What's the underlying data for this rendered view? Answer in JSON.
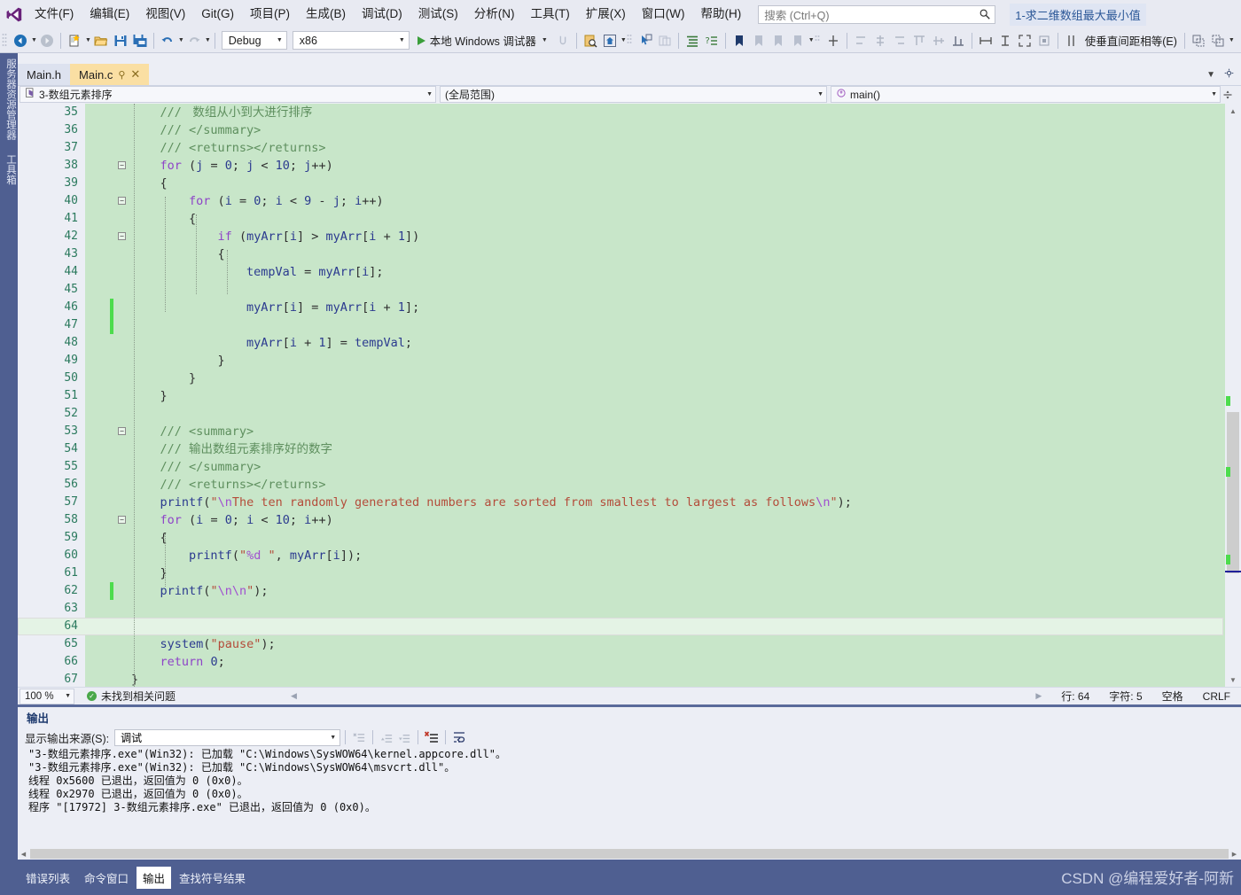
{
  "menubar": {
    "logo_icon": "visual-studio-logo",
    "items": [
      {
        "label": "文件(F)"
      },
      {
        "label": "编辑(E)"
      },
      {
        "label": "视图(V)"
      },
      {
        "label": "Git(G)"
      },
      {
        "label": "项目(P)"
      },
      {
        "label": "生成(B)"
      },
      {
        "label": "调试(D)"
      },
      {
        "label": "测试(S)"
      },
      {
        "label": "分析(N)"
      },
      {
        "label": "工具(T)"
      },
      {
        "label": "扩展(X)"
      },
      {
        "label": "窗口(W)"
      },
      {
        "label": "帮助(H)"
      }
    ],
    "search_placeholder": "搜索 (Ctrl+Q)",
    "search_icon": "search-icon",
    "project_chip": "1-求二维数组最大最小值"
  },
  "toolbar": {
    "nav_back_icon": "navigate-back-icon",
    "nav_forward_icon": "navigate-forward-icon",
    "new_item_icon": "new-item-icon",
    "open_file_icon": "open-folder-icon",
    "save_icon": "save-icon",
    "save_all_icon": "save-all-icon",
    "undo_icon": "undo-icon",
    "redo_icon": "redo-icon",
    "config_value": "Debug",
    "platform_value": "x86",
    "run_label": "本地 Windows 调试器",
    "run_icon": "play-icon",
    "equal_vertical_spacing_label": "使垂直间距相等(E)"
  },
  "left_dock": {
    "tabs": [
      {
        "label": "服务器资源管理器"
      },
      {
        "label": "工具箱"
      }
    ]
  },
  "editor": {
    "tabs": [
      {
        "label": "Main.h",
        "active": false,
        "pinned": false,
        "closable": false
      },
      {
        "label": "Main.c",
        "active": true,
        "pinned": true,
        "closable": true
      }
    ],
    "pin_icon": "pin-icon",
    "close_icon": "close-icon",
    "navbar": {
      "project_icon": "c-file-icon",
      "project": "3-数组元素排序",
      "scope": "(全局范围)",
      "member_icon": "method-icon",
      "member": "main()",
      "split_icon": "split-editor-icon"
    },
    "first_line_number": 35,
    "current_line": 64,
    "lines": [
      {
        "n": 35,
        "indent": 1,
        "changed": false,
        "fold": null,
        "tokens": [
          {
            "t": "com",
            "s": "/// "
          },
          {
            "t": "cjk",
            "s": " 数组从小到大进行排序"
          }
        ]
      },
      {
        "n": 36,
        "indent": 1,
        "changed": false,
        "fold": null,
        "tokens": [
          {
            "t": "com",
            "s": "/// </summary>"
          }
        ]
      },
      {
        "n": 37,
        "indent": 1,
        "changed": false,
        "fold": null,
        "tokens": [
          {
            "t": "com",
            "s": "/// <returns></returns>"
          }
        ]
      },
      {
        "n": 38,
        "indent": 1,
        "changed": false,
        "fold": "minus",
        "tokens": [
          {
            "t": "kw",
            "s": "for"
          },
          {
            "t": "pun",
            "s": " ("
          },
          {
            "t": "var",
            "s": "j"
          },
          {
            "t": "pun",
            "s": " = "
          },
          {
            "t": "num",
            "s": "0"
          },
          {
            "t": "pun",
            "s": "; "
          },
          {
            "t": "var",
            "s": "j"
          },
          {
            "t": "pun",
            "s": " < "
          },
          {
            "t": "num",
            "s": "10"
          },
          {
            "t": "pun",
            "s": "; "
          },
          {
            "t": "var",
            "s": "j"
          },
          {
            "t": "pun",
            "s": "++)"
          }
        ]
      },
      {
        "n": 39,
        "indent": 1,
        "changed": false,
        "fold": null,
        "tokens": [
          {
            "t": "pun",
            "s": "{"
          }
        ]
      },
      {
        "n": 40,
        "indent": 2,
        "changed": false,
        "fold": "minus",
        "tokens": [
          {
            "t": "kw",
            "s": "for"
          },
          {
            "t": "pun",
            "s": " ("
          },
          {
            "t": "var",
            "s": "i"
          },
          {
            "t": "pun",
            "s": " = "
          },
          {
            "t": "num",
            "s": "0"
          },
          {
            "t": "pun",
            "s": "; "
          },
          {
            "t": "var",
            "s": "i"
          },
          {
            "t": "pun",
            "s": " < "
          },
          {
            "t": "num",
            "s": "9"
          },
          {
            "t": "pun",
            "s": " - "
          },
          {
            "t": "var",
            "s": "j"
          },
          {
            "t": "pun",
            "s": "; "
          },
          {
            "t": "var",
            "s": "i"
          },
          {
            "t": "pun",
            "s": "++)"
          }
        ]
      },
      {
        "n": 41,
        "indent": 2,
        "changed": false,
        "fold": null,
        "tokens": [
          {
            "t": "pun",
            "s": "{"
          }
        ]
      },
      {
        "n": 42,
        "indent": 3,
        "changed": false,
        "fold": "minus",
        "tokens": [
          {
            "t": "kw",
            "s": "if"
          },
          {
            "t": "pun",
            "s": " ("
          },
          {
            "t": "var",
            "s": "myArr"
          },
          {
            "t": "pun",
            "s": "["
          },
          {
            "t": "var",
            "s": "i"
          },
          {
            "t": "pun",
            "s": "] > "
          },
          {
            "t": "var",
            "s": "myArr"
          },
          {
            "t": "pun",
            "s": "["
          },
          {
            "t": "var",
            "s": "i"
          },
          {
            "t": "pun",
            "s": " + "
          },
          {
            "t": "num",
            "s": "1"
          },
          {
            "t": "pun",
            "s": "])"
          }
        ]
      },
      {
        "n": 43,
        "indent": 3,
        "changed": false,
        "fold": null,
        "tokens": [
          {
            "t": "pun",
            "s": "{"
          }
        ]
      },
      {
        "n": 44,
        "indent": 4,
        "changed": false,
        "fold": null,
        "tokens": [
          {
            "t": "var",
            "s": "tempVal"
          },
          {
            "t": "pun",
            "s": " = "
          },
          {
            "t": "var",
            "s": "myArr"
          },
          {
            "t": "pun",
            "s": "["
          },
          {
            "t": "var",
            "s": "i"
          },
          {
            "t": "pun",
            "s": "];"
          }
        ]
      },
      {
        "n": 45,
        "indent": 0,
        "changed": false,
        "fold": null,
        "tokens": []
      },
      {
        "n": 46,
        "indent": 4,
        "changed": true,
        "fold": null,
        "tokens": [
          {
            "t": "var",
            "s": "myArr"
          },
          {
            "t": "pun",
            "s": "["
          },
          {
            "t": "var",
            "s": "i"
          },
          {
            "t": "pun",
            "s": "] = "
          },
          {
            "t": "var",
            "s": "myArr"
          },
          {
            "t": "pun",
            "s": "["
          },
          {
            "t": "var",
            "s": "i"
          },
          {
            "t": "pun",
            "s": " + "
          },
          {
            "t": "num",
            "s": "1"
          },
          {
            "t": "pun",
            "s": "];"
          }
        ]
      },
      {
        "n": 47,
        "indent": 0,
        "changed": true,
        "fold": null,
        "tokens": []
      },
      {
        "n": 48,
        "indent": 4,
        "changed": false,
        "fold": null,
        "tokens": [
          {
            "t": "var",
            "s": "myArr"
          },
          {
            "t": "pun",
            "s": "["
          },
          {
            "t": "var",
            "s": "i"
          },
          {
            "t": "pun",
            "s": " + "
          },
          {
            "t": "num",
            "s": "1"
          },
          {
            "t": "pun",
            "s": "] = "
          },
          {
            "t": "var",
            "s": "tempVal"
          },
          {
            "t": "pun",
            "s": ";"
          }
        ]
      },
      {
        "n": 49,
        "indent": 3,
        "changed": false,
        "fold": null,
        "tokens": [
          {
            "t": "pun",
            "s": "}"
          }
        ]
      },
      {
        "n": 50,
        "indent": 2,
        "changed": false,
        "fold": null,
        "tokens": [
          {
            "t": "pun",
            "s": "}"
          }
        ]
      },
      {
        "n": 51,
        "indent": 1,
        "changed": false,
        "fold": null,
        "tokens": [
          {
            "t": "pun",
            "s": "}"
          }
        ]
      },
      {
        "n": 52,
        "indent": 0,
        "changed": false,
        "fold": null,
        "tokens": []
      },
      {
        "n": 53,
        "indent": 1,
        "changed": false,
        "fold": "minus",
        "tokens": [
          {
            "t": "com",
            "s": "/// <summary>"
          }
        ]
      },
      {
        "n": 54,
        "indent": 1,
        "changed": false,
        "fold": null,
        "tokens": [
          {
            "t": "com",
            "s": "/// "
          },
          {
            "t": "cjk",
            "s": "输出数组元素排序好的数字"
          }
        ]
      },
      {
        "n": 55,
        "indent": 1,
        "changed": false,
        "fold": null,
        "tokens": [
          {
            "t": "com",
            "s": "/// </summary>"
          }
        ]
      },
      {
        "n": 56,
        "indent": 1,
        "changed": false,
        "fold": null,
        "tokens": [
          {
            "t": "com",
            "s": "/// <returns></returns>"
          }
        ]
      },
      {
        "n": 57,
        "indent": 1,
        "changed": false,
        "fold": null,
        "tokens": [
          {
            "t": "fn",
            "s": "printf"
          },
          {
            "t": "pun",
            "s": "("
          },
          {
            "t": "str",
            "s": "\""
          },
          {
            "t": "esc",
            "s": "\\n"
          },
          {
            "t": "str",
            "s": "The ten randomly generated numbers are sorted from smallest to largest as follows"
          },
          {
            "t": "esc",
            "s": "\\n"
          },
          {
            "t": "str",
            "s": "\""
          },
          {
            "t": "pun",
            "s": ");"
          }
        ]
      },
      {
        "n": 58,
        "indent": 1,
        "changed": false,
        "fold": "minus",
        "tokens": [
          {
            "t": "kw",
            "s": "for"
          },
          {
            "t": "pun",
            "s": " ("
          },
          {
            "t": "var",
            "s": "i"
          },
          {
            "t": "pun",
            "s": " = "
          },
          {
            "t": "num",
            "s": "0"
          },
          {
            "t": "pun",
            "s": "; "
          },
          {
            "t": "var",
            "s": "i"
          },
          {
            "t": "pun",
            "s": " < "
          },
          {
            "t": "num",
            "s": "10"
          },
          {
            "t": "pun",
            "s": "; "
          },
          {
            "t": "var",
            "s": "i"
          },
          {
            "t": "pun",
            "s": "++)"
          }
        ]
      },
      {
        "n": 59,
        "indent": 1,
        "changed": false,
        "fold": null,
        "tokens": [
          {
            "t": "pun",
            "s": "{"
          }
        ]
      },
      {
        "n": 60,
        "indent": 2,
        "changed": false,
        "fold": null,
        "tokens": [
          {
            "t": "fn",
            "s": "printf"
          },
          {
            "t": "pun",
            "s": "("
          },
          {
            "t": "str",
            "s": "\""
          },
          {
            "t": "esc",
            "s": "%d"
          },
          {
            "t": "str",
            "s": " \""
          },
          {
            "t": "pun",
            "s": ", "
          },
          {
            "t": "var",
            "s": "myArr"
          },
          {
            "t": "pun",
            "s": "["
          },
          {
            "t": "var",
            "s": "i"
          },
          {
            "t": "pun",
            "s": "]);"
          }
        ]
      },
      {
        "n": 61,
        "indent": 1,
        "changed": false,
        "fold": null,
        "tokens": [
          {
            "t": "pun",
            "s": "}"
          }
        ]
      },
      {
        "n": 62,
        "indent": 1,
        "changed": true,
        "fold": null,
        "tokens": [
          {
            "t": "fn",
            "s": "printf"
          },
          {
            "t": "pun",
            "s": "("
          },
          {
            "t": "str",
            "s": "\""
          },
          {
            "t": "esc",
            "s": "\\n\\n"
          },
          {
            "t": "str",
            "s": "\""
          },
          {
            "t": "pun",
            "s": ");"
          }
        ]
      },
      {
        "n": 63,
        "indent": 0,
        "changed": false,
        "fold": null,
        "tokens": []
      },
      {
        "n": 64,
        "indent": 0,
        "changed": false,
        "fold": null,
        "tokens": []
      },
      {
        "n": 65,
        "indent": 1,
        "changed": false,
        "fold": null,
        "tokens": [
          {
            "t": "fn",
            "s": "system"
          },
          {
            "t": "pun",
            "s": "("
          },
          {
            "t": "str",
            "s": "\"pause\""
          },
          {
            "t": "pun",
            "s": ");"
          }
        ]
      },
      {
        "n": 66,
        "indent": 1,
        "changed": false,
        "fold": null,
        "tokens": [
          {
            "t": "kw",
            "s": "return"
          },
          {
            "t": "pun",
            "s": " "
          },
          {
            "t": "num",
            "s": "0"
          },
          {
            "t": "pun",
            "s": ";"
          }
        ]
      },
      {
        "n": 67,
        "indent": 0,
        "changed": false,
        "fold": null,
        "tokens": [
          {
            "t": "pun",
            "s": "}"
          }
        ]
      }
    ],
    "status": {
      "zoom": "100 %",
      "issues_icon": "check-circle-icon",
      "issues": "未找到相关问题",
      "line_label": "行: 64",
      "col_label": "字符: 5",
      "space_label": "空格",
      "eol_label": "CRLF"
    }
  },
  "output_panel": {
    "title": "输出",
    "source_label": "显示输出来源(S):",
    "source_value": "调试",
    "clear_icon": "clear-all-icon",
    "prev_icon": "go-to-previous-icon",
    "next_icon": "go-to-next-icon",
    "clear_pane_icon": "clear-pane-icon",
    "wordwrap_icon": "toggle-word-wrap-icon",
    "lines": [
      "\"3-数组元素排序.exe\"(Win32): 已加载 \"C:\\Windows\\SysWOW64\\kernel.appcore.dll\"。",
      "\"3-数组元素排序.exe\"(Win32): 已加载 \"C:\\Windows\\SysWOW64\\msvcrt.dll\"。",
      "线程 0x5600 已退出，返回值为 0 (0x0)。",
      "线程 0x2970 已退出，返回值为 0 (0x0)。",
      "程序 \"[17972] 3-数组元素排序.exe\" 已退出，返回值为 0 (0x0)。"
    ]
  },
  "bottom_tabs": [
    {
      "label": "错误列表",
      "active": false
    },
    {
      "label": "命令窗口",
      "active": false
    },
    {
      "label": "输出",
      "active": true
    },
    {
      "label": "查找符号结果",
      "active": false
    }
  ],
  "watermark": "CSDN @编程爱好者-阿新",
  "colors": {
    "accent": "#4f5f91",
    "code_bg": "#c8e6c9",
    "current_line_bg": "#e4f3e5",
    "change_bar": "#4ddc4d",
    "chrome": "#e8eaf2",
    "active_tab": "#fadfa3"
  }
}
